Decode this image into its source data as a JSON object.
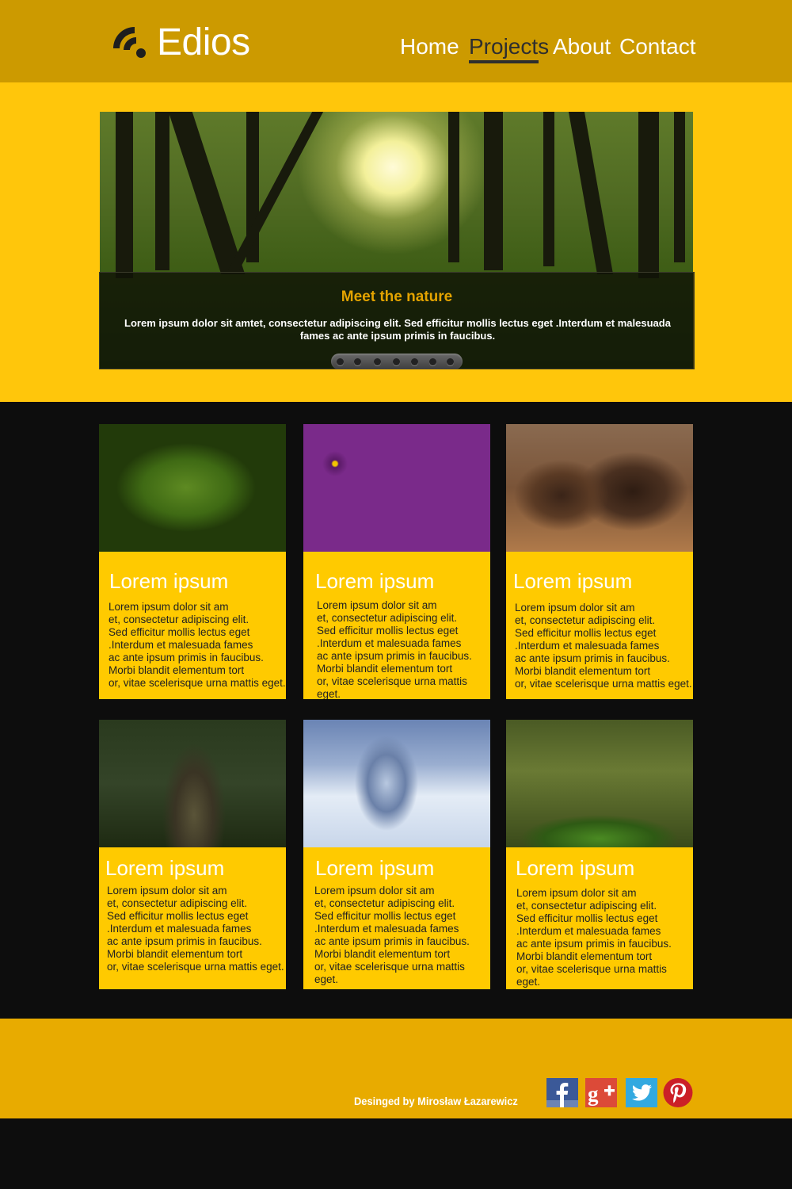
{
  "header": {
    "logo_text": "Edios",
    "nav": [
      {
        "label": "Home",
        "active": false
      },
      {
        "label": "Projects",
        "active": true
      },
      {
        "label": "About",
        "active": false
      },
      {
        "label": "Contact",
        "active": false
      }
    ]
  },
  "slider": {
    "title": "Meet the nature",
    "text": "Lorem ipsum dolor sit amtet, consectetur adipiscing elit. Sed efficitur mollis lectus eget .Interdum et malesuada fames ac ante ipsum primis in faucibus.",
    "dots": 7
  },
  "cards": [
    {
      "title": "Lorem ipsum",
      "text": "Lorem ipsum dolor sit am\net, consectetur adipiscing elit.\nSed efficitur mollis lectus eget\n.Interdum et malesuada fames\nac ante ipsum primis in faucibus.\nMorbi blandit elementum tort\nor, vitae scelerisque urna mattis eget."
    },
    {
      "title": "Lorem ipsum",
      "text": "Lorem ipsum dolor sit am\net, consectetur adipiscing elit.\nSed efficitur mollis lectus eget\n.Interdum et malesuada fames\nac ante ipsum primis in faucibus.\nMorbi blandit elementum tort\nor, vitae scelerisque urna mattis eget."
    },
    {
      "title": "Lorem ipsum",
      "text": "Lorem ipsum dolor sit am\net, consectetur adipiscing elit.\nSed efficitur mollis lectus eget\n.Interdum et malesuada fames\nac ante ipsum primis in faucibus.\nMorbi blandit elementum tort\nor, vitae scelerisque urna mattis eget."
    },
    {
      "title": "Lorem ipsum",
      "text": "Lorem ipsum dolor sit am\net, consectetur adipiscing elit.\nSed efficitur mollis lectus eget\n.Interdum et malesuada fames\nac ante ipsum primis in faucibus.\nMorbi blandit elementum tort\nor, vitae scelerisque urna mattis eget."
    },
    {
      "title": "Lorem ipsum",
      "text": "Lorem ipsum dolor sit am\net, consectetur adipiscing elit.\nSed efficitur mollis lectus eget\n.Interdum et malesuada fames\nac ante ipsum primis in faucibus.\nMorbi blandit elementum tort\nor, vitae scelerisque urna mattis eget."
    },
    {
      "title": "Lorem ipsum",
      "text": "Lorem ipsum dolor sit am\net, consectetur adipiscing elit.\nSed efficitur mollis lectus eget\n.Interdum et malesuada fames\nac ante ipsum primis in faucibus.\nMorbi blandit elementum tort\nor, vitae scelerisque urna mattis eget."
    }
  ],
  "footer": {
    "credit": "Desinged by Mirosław Łazarewicz",
    "social": [
      "facebook-icon",
      "google-plus-icon",
      "twitter-icon",
      "pinterest-icon"
    ]
  },
  "colors": {
    "header_bg": "#cc9a00",
    "hero_band_bg": "#ffc60b",
    "card_bg": "#ffca00",
    "footer_bg": "#e8ab00",
    "dark_bg": "#0d0d0d",
    "slider_title": "#e3a300"
  }
}
